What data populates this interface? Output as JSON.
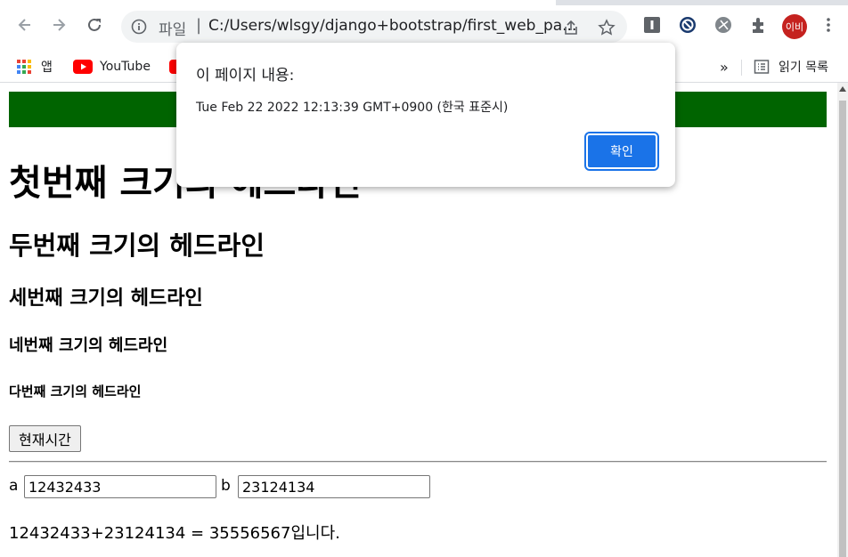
{
  "browser": {
    "address": {
      "scheme_label": "파일",
      "separator": "|",
      "url": "C:/Users/wlsgy/django+bootstrap/first_web_pa..."
    },
    "profile": {
      "avatar_text": "이비",
      "color": "#c5221f"
    },
    "icons": [
      "back-icon",
      "forward-icon",
      "reload-icon",
      "info-icon",
      "share-icon",
      "star-icon",
      "extension-i-icon",
      "extension-block-icon",
      "extension-globe-icon",
      "puzzle-icon",
      "more-icon"
    ]
  },
  "bookmarks": {
    "apps_label": "앱",
    "youtube_label": "YouTube",
    "overflow_label": "»",
    "reading_list_label": "읽기 목록"
  },
  "page": {
    "banner_color": "#006400",
    "headings": {
      "h1": "첫번째 크기의 헤드라인",
      "h2": "두번째 크기의 헤드라인",
      "h3": "세번째 크기의 헤드라인",
      "h4": "네번째 크기의 헤드라인",
      "h5": "다번째 크기의 헤드라인"
    },
    "time_button_label": "현재시간",
    "form": {
      "a_label": "a",
      "a_value": "12432433",
      "b_label": "b",
      "b_value": "23124134"
    },
    "result_text": "12432433+23124134 = 35556567입니다."
  },
  "dialog": {
    "title": "이 페이지 내용:",
    "message": "Tue Feb 22 2022 12:13:39 GMT+0900 (한국 표준시)",
    "ok_label": "확인",
    "accent_color": "#1a73e8"
  }
}
